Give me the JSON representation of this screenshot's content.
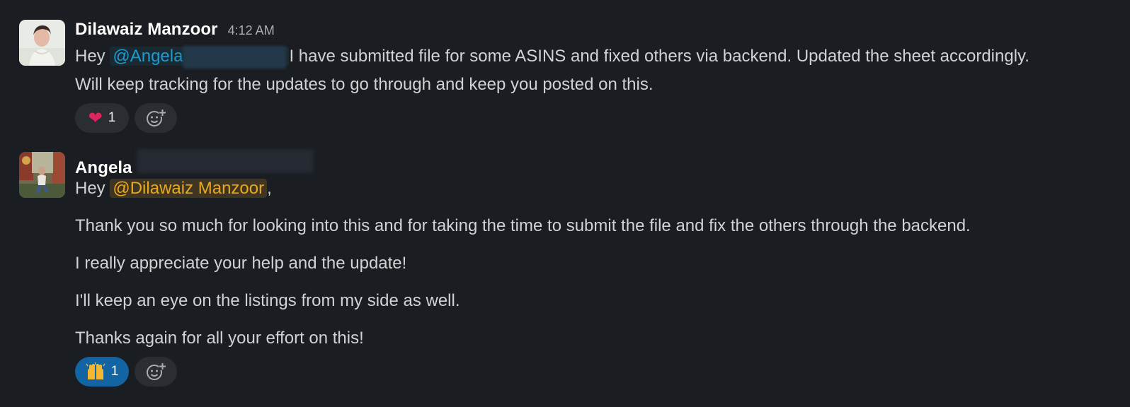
{
  "messages": [
    {
      "sender": "Dilawaiz Manzoor",
      "timestamp": "4:12 AM",
      "mention": "@Angela",
      "line1_after": "I have submitted file for some ASINS and fixed others via backend. Updated the sheet accordingly.",
      "line2": "Will keep tracking for the updates to go through and keep you posted on this.",
      "greeting": "Hey",
      "reaction": {
        "emoji": "❤️",
        "count": "1"
      }
    },
    {
      "sender": "Angela",
      "greeting": "Hey",
      "mention": "@Dilawaiz Manzoor",
      "comma": ",",
      "paragraphs": [
        "Thank you so much for looking into this and for taking the time to submit the file and fix the others through the backend.",
        "I really appreciate your help and the update!",
        "I'll keep an eye on the listings from my side as well.",
        "Thanks again for all your effort on this!"
      ],
      "reaction": {
        "emoji": "🙌",
        "count": "1"
      }
    }
  ],
  "icons": {
    "add_reaction": "add-reaction-icon"
  },
  "colors": {
    "background": "#1a1d21",
    "mention_blue": "#1d9bd1",
    "mention_yellow": "#e8a821",
    "active_reaction": "#1264a3"
  }
}
